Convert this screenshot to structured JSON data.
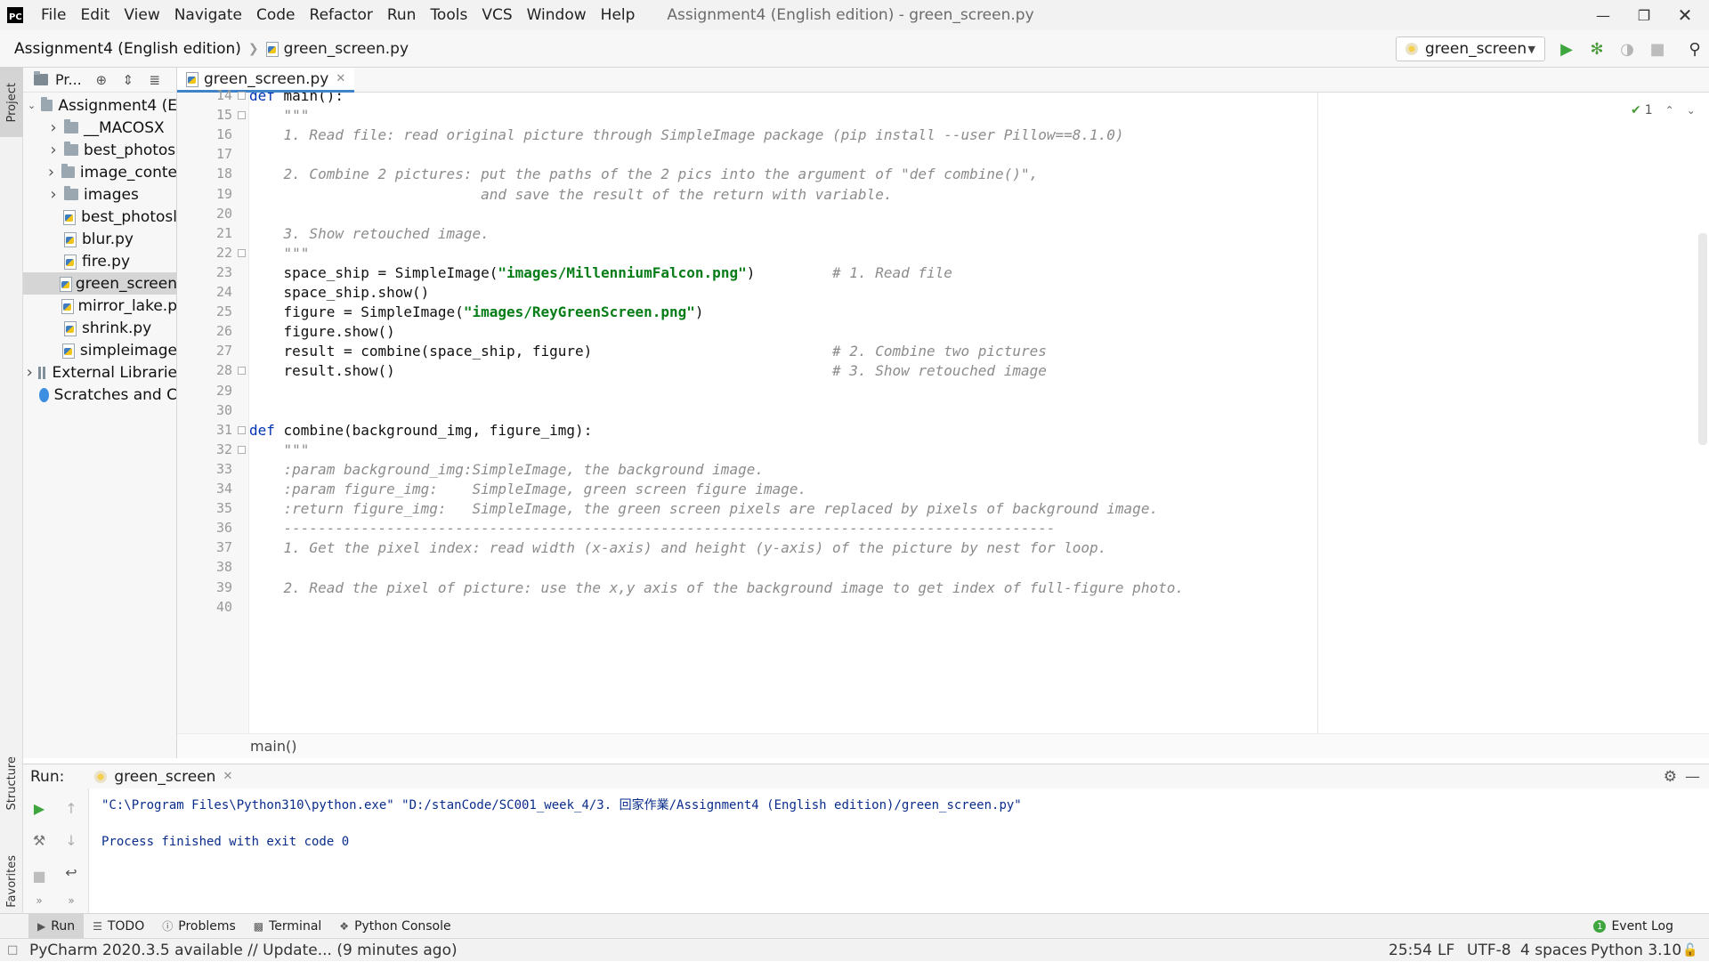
{
  "menu": {
    "items": [
      "File",
      "Edit",
      "View",
      "Navigate",
      "Code",
      "Refactor",
      "Run",
      "Tools",
      "VCS",
      "Window",
      "Help"
    ],
    "window_title": "Assignment4 (English edition) - green_screen.py"
  },
  "navbar": {
    "project": "Assignment4 (English edition)",
    "file": "green_screen.py",
    "run_config": "green_screen"
  },
  "left_stripe": {
    "project": "Project",
    "structure": "Structure",
    "favorites": "Favorites"
  },
  "project_panel": {
    "title": "Pr...",
    "tree": [
      {
        "label": "Assignment4 (E",
        "type": "folder",
        "arrow": "down"
      },
      {
        "label": "__MACOSX",
        "type": "folder",
        "arrow": "right"
      },
      {
        "label": "best_photos",
        "type": "folder",
        "arrow": "right"
      },
      {
        "label": "image_conte",
        "type": "folder",
        "arrow": "right"
      },
      {
        "label": "images",
        "type": "folder",
        "arrow": "right"
      },
      {
        "label": "best_photosl",
        "type": "py"
      },
      {
        "label": "blur.py",
        "type": "py"
      },
      {
        "label": "fire.py",
        "type": "py"
      },
      {
        "label": "green_screen",
        "type": "py",
        "selected": true
      },
      {
        "label": "mirror_lake.p",
        "type": "py"
      },
      {
        "label": "shrink.py",
        "type": "py"
      },
      {
        "label": "simpleimage",
        "type": "py"
      },
      {
        "label": "External Librarie",
        "type": "lib",
        "arrow": "right"
      },
      {
        "label": "Scratches and C",
        "type": "scratch"
      }
    ]
  },
  "editor": {
    "tab": "green_screen.py",
    "inspection_count": "1",
    "breadcrumb": "main()",
    "current_line": 25,
    "lines": [
      {
        "n": "14",
        "code": "def main():"
      },
      {
        "n": "15",
        "code": "    \"\"\""
      },
      {
        "n": "16",
        "code": "    1. Read file: read original picture through SimpleImage package (pip install --user Pillow==8.1.0)"
      },
      {
        "n": "17",
        "code": ""
      },
      {
        "n": "18",
        "code": "    2. Combine 2 pictures: put the paths of the 2 pics into the argument of \"def combine()\","
      },
      {
        "n": "19",
        "code": "                           and save the result of the return with variable."
      },
      {
        "n": "20",
        "code": ""
      },
      {
        "n": "21",
        "code": "    3. Show retouched image."
      },
      {
        "n": "22",
        "code": "    \"\"\""
      },
      {
        "n": "23",
        "code": "    space_ship = SimpleImage(\"images/MillenniumFalcon.png\")         # 1. Read file"
      },
      {
        "n": "24",
        "code": "    space_ship.show()"
      },
      {
        "n": "25",
        "code": "    figure = SimpleImage(\"images/ReyGreenScreen.png\")"
      },
      {
        "n": "26",
        "code": "    figure.show()"
      },
      {
        "n": "27",
        "code": "    result = combine(space_ship, figure)                            # 2. Combine two pictures"
      },
      {
        "n": "28",
        "code": "    result.show()                                                   # 3. Show retouched image"
      },
      {
        "n": "29",
        "code": ""
      },
      {
        "n": "30",
        "code": ""
      },
      {
        "n": "31",
        "code": "def combine(background_img, figure_img):"
      },
      {
        "n": "32",
        "code": "    \"\"\""
      },
      {
        "n": "33",
        "code": "    :param background_img:SimpleImage, the background image."
      },
      {
        "n": "34",
        "code": "    :param figure_img:    SimpleImage, green screen figure image."
      },
      {
        "n": "35",
        "code": "    :return figure_img:   SimpleImage, the green screen pixels are replaced by pixels of background image."
      },
      {
        "n": "36",
        "code": "    ------------------------------------------------------------------------------------------"
      },
      {
        "n": "37",
        "code": "    1. Get the pixel index: read width (x-axis) and height (y-axis) of the picture by nest for loop."
      },
      {
        "n": "38",
        "code": ""
      },
      {
        "n": "39",
        "code": "    2. Read the pixel of picture: use the x,y axis of the background image to get index of full-figure photo."
      },
      {
        "n": "40",
        "code": ""
      }
    ]
  },
  "run": {
    "label": "Run:",
    "tab": "green_screen",
    "command": "\"C:\\Program Files\\Python310\\python.exe\" \"D:/stanCode/SC001_week_4/3. 回家作業/Assignment4 (English edition)/green_screen.py\"",
    "exit": "Process finished with exit code 0"
  },
  "tool_tabs": {
    "run": "Run",
    "todo": "TODO",
    "problems": "Problems",
    "terminal": "Terminal",
    "python_console": "Python Console",
    "event_log": "Event Log"
  },
  "status": {
    "message": "PyCharm 2020.3.5 available // Update... (9 minutes ago)",
    "position": "25:54",
    "line_sep": "LF",
    "encoding": "UTF-8",
    "indent": "4 spaces",
    "interpreter": "Python 3.10"
  },
  "colors": {
    "keyword": "#0033b3",
    "string": "#067d17",
    "comment": "#8c8c8c",
    "accent": "#4083c9",
    "run_green": "#3fa63f"
  }
}
